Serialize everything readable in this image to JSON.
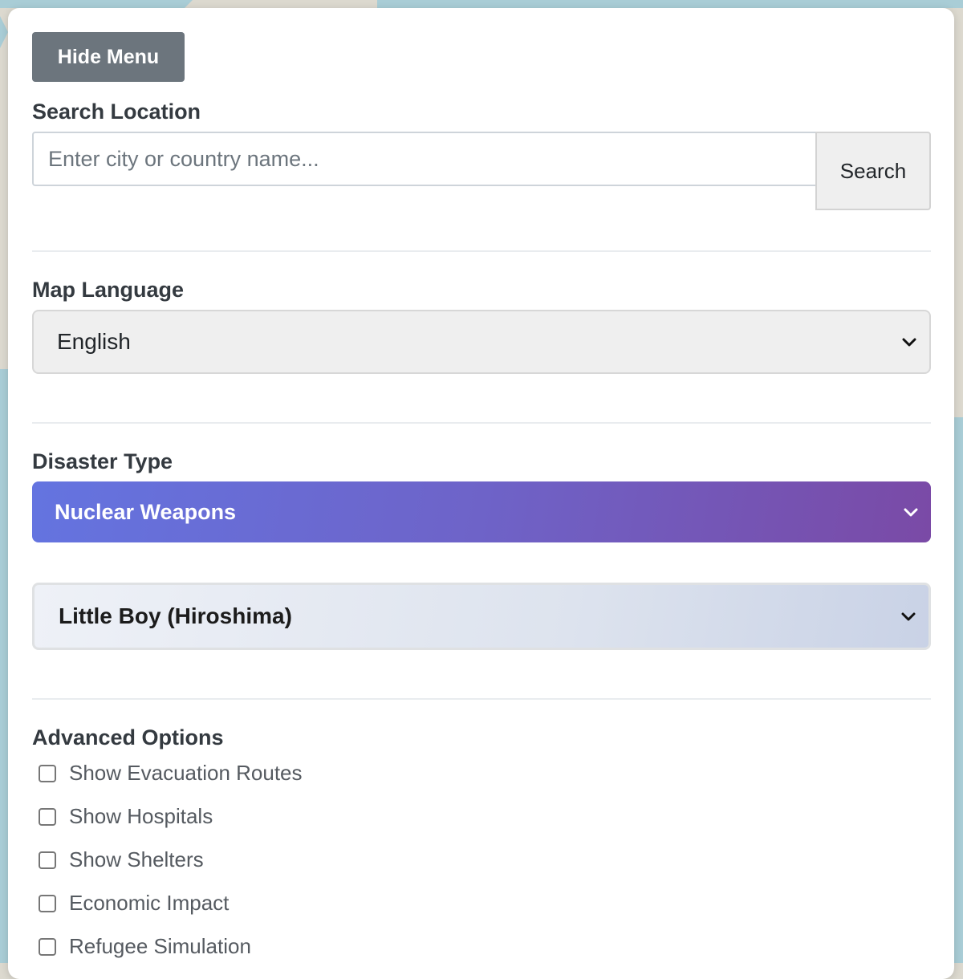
{
  "menu": {
    "hide_label": "Hide Menu"
  },
  "search": {
    "label": "Search Location",
    "placeholder": "Enter city or country name...",
    "button_label": "Search"
  },
  "map_language": {
    "label": "Map Language",
    "selected": "English"
  },
  "disaster": {
    "label": "Disaster Type",
    "type_selected": "Nuclear Weapons",
    "weapon_selected": "Little Boy (Hiroshima)"
  },
  "advanced": {
    "label": "Advanced Options",
    "options": [
      {
        "label": "Show Evacuation Routes",
        "checked": false
      },
      {
        "label": "Show Hospitals",
        "checked": false
      },
      {
        "label": "Show Shelters",
        "checked": false
      },
      {
        "label": "Economic Impact",
        "checked": false
      },
      {
        "label": "Refugee Simulation",
        "checked": false
      }
    ]
  },
  "colors": {
    "hide_button": "#6c757d",
    "disaster_gradient_start": "#6474e0",
    "disaster_gradient_end": "#7a4aa6",
    "map_water": "#a9cdd6",
    "map_land": "#dcd9cf"
  }
}
